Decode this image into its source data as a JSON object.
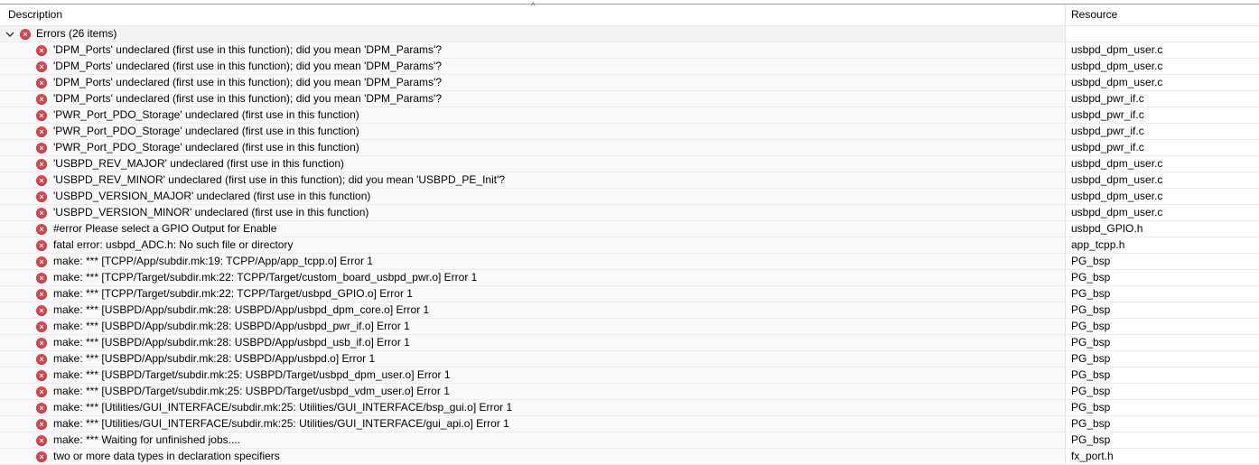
{
  "columns": {
    "description": "Description",
    "resource": "Resource"
  },
  "sort_indicator": "^",
  "group": {
    "label": "Errors (26 items)",
    "icon": "error-icon",
    "expanded": true
  },
  "colors": {
    "error": "#d9434a"
  },
  "items": [
    {
      "description": "'DPM_Ports' undeclared (first use in this function); did you mean 'DPM_Params'?",
      "resource": "usbpd_dpm_user.c"
    },
    {
      "description": "'DPM_Ports' undeclared (first use in this function); did you mean 'DPM_Params'?",
      "resource": "usbpd_dpm_user.c"
    },
    {
      "description": "'DPM_Ports' undeclared (first use in this function); did you mean 'DPM_Params'?",
      "resource": "usbpd_dpm_user.c"
    },
    {
      "description": "'DPM_Ports' undeclared (first use in this function); did you mean 'DPM_Params'?",
      "resource": "usbpd_pwr_if.c"
    },
    {
      "description": "'PWR_Port_PDO_Storage' undeclared (first use in this function)",
      "resource": "usbpd_pwr_if.c"
    },
    {
      "description": "'PWR_Port_PDO_Storage' undeclared (first use in this function)",
      "resource": "usbpd_pwr_if.c"
    },
    {
      "description": "'PWR_Port_PDO_Storage' undeclared (first use in this function)",
      "resource": "usbpd_pwr_if.c"
    },
    {
      "description": "'USBPD_REV_MAJOR' undeclared (first use in this function)",
      "resource": "usbpd_dpm_user.c"
    },
    {
      "description": "'USBPD_REV_MINOR' undeclared (first use in this function); did you mean 'USBPD_PE_Init'?",
      "resource": "usbpd_dpm_user.c"
    },
    {
      "description": "'USBPD_VERSION_MAJOR' undeclared (first use in this function)",
      "resource": "usbpd_dpm_user.c"
    },
    {
      "description": "'USBPD_VERSION_MINOR' undeclared (first use in this function)",
      "resource": "usbpd_dpm_user.c"
    },
    {
      "description": "#error Please select a GPIO Output for Enable",
      "resource": "usbpd_GPIO.h"
    },
    {
      "description": "fatal error: usbpd_ADC.h: No such file or directory",
      "resource": "app_tcpp.h"
    },
    {
      "description": "make: *** [TCPP/App/subdir.mk:19: TCPP/App/app_tcpp.o] Error 1",
      "resource": "PG_bsp"
    },
    {
      "description": "make: *** [TCPP/Target/subdir.mk:22: TCPP/Target/custom_board_usbpd_pwr.o] Error 1",
      "resource": "PG_bsp"
    },
    {
      "description": "make: *** [TCPP/Target/subdir.mk:22: TCPP/Target/usbpd_GPIO.o] Error 1",
      "resource": "PG_bsp"
    },
    {
      "description": "make: *** [USBPD/App/subdir.mk:28: USBPD/App/usbpd_dpm_core.o] Error 1",
      "resource": "PG_bsp"
    },
    {
      "description": "make: *** [USBPD/App/subdir.mk:28: USBPD/App/usbpd_pwr_if.o] Error 1",
      "resource": "PG_bsp"
    },
    {
      "description": "make: *** [USBPD/App/subdir.mk:28: USBPD/App/usbpd_usb_if.o] Error 1",
      "resource": "PG_bsp"
    },
    {
      "description": "make: *** [USBPD/App/subdir.mk:28: USBPD/App/usbpd.o] Error 1",
      "resource": "PG_bsp"
    },
    {
      "description": "make: *** [USBPD/Target/subdir.mk:25: USBPD/Target/usbpd_dpm_user.o] Error 1",
      "resource": "PG_bsp"
    },
    {
      "description": "make: *** [USBPD/Target/subdir.mk:25: USBPD/Target/usbpd_vdm_user.o] Error 1",
      "resource": "PG_bsp"
    },
    {
      "description": "make: *** [Utilities/GUI_INTERFACE/subdir.mk:25: Utilities/GUI_INTERFACE/bsp_gui.o] Error 1",
      "resource": "PG_bsp"
    },
    {
      "description": "make: *** [Utilities/GUI_INTERFACE/subdir.mk:25: Utilities/GUI_INTERFACE/gui_api.o] Error 1",
      "resource": "PG_bsp"
    },
    {
      "description": "make: *** Waiting for unfinished jobs....",
      "resource": "PG_bsp"
    },
    {
      "description": "two or more data types in declaration specifiers",
      "resource": "fx_port.h"
    }
  ]
}
